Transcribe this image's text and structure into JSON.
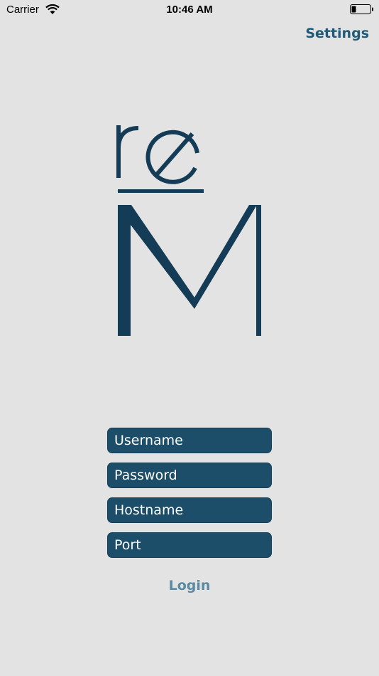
{
  "status_bar": {
    "carrier": "Carrier",
    "time": "10:46 AM",
    "wifi_icon": "wifi-icon",
    "battery_icon": "battery-icon"
  },
  "nav": {
    "settings_label": "Settings"
  },
  "logo": {
    "icon": "remote-logo",
    "letters": "reM",
    "color": "#143c56"
  },
  "form": {
    "username_placeholder": "Username",
    "password_placeholder": "Password",
    "hostname_placeholder": "Hostname",
    "port_placeholder": "Port",
    "login_label": "Login"
  },
  "colors": {
    "background": "#e3e3e3",
    "field_fill": "#1c4d69",
    "accent": "#1f5a78",
    "login_text": "#5b8aa3"
  }
}
